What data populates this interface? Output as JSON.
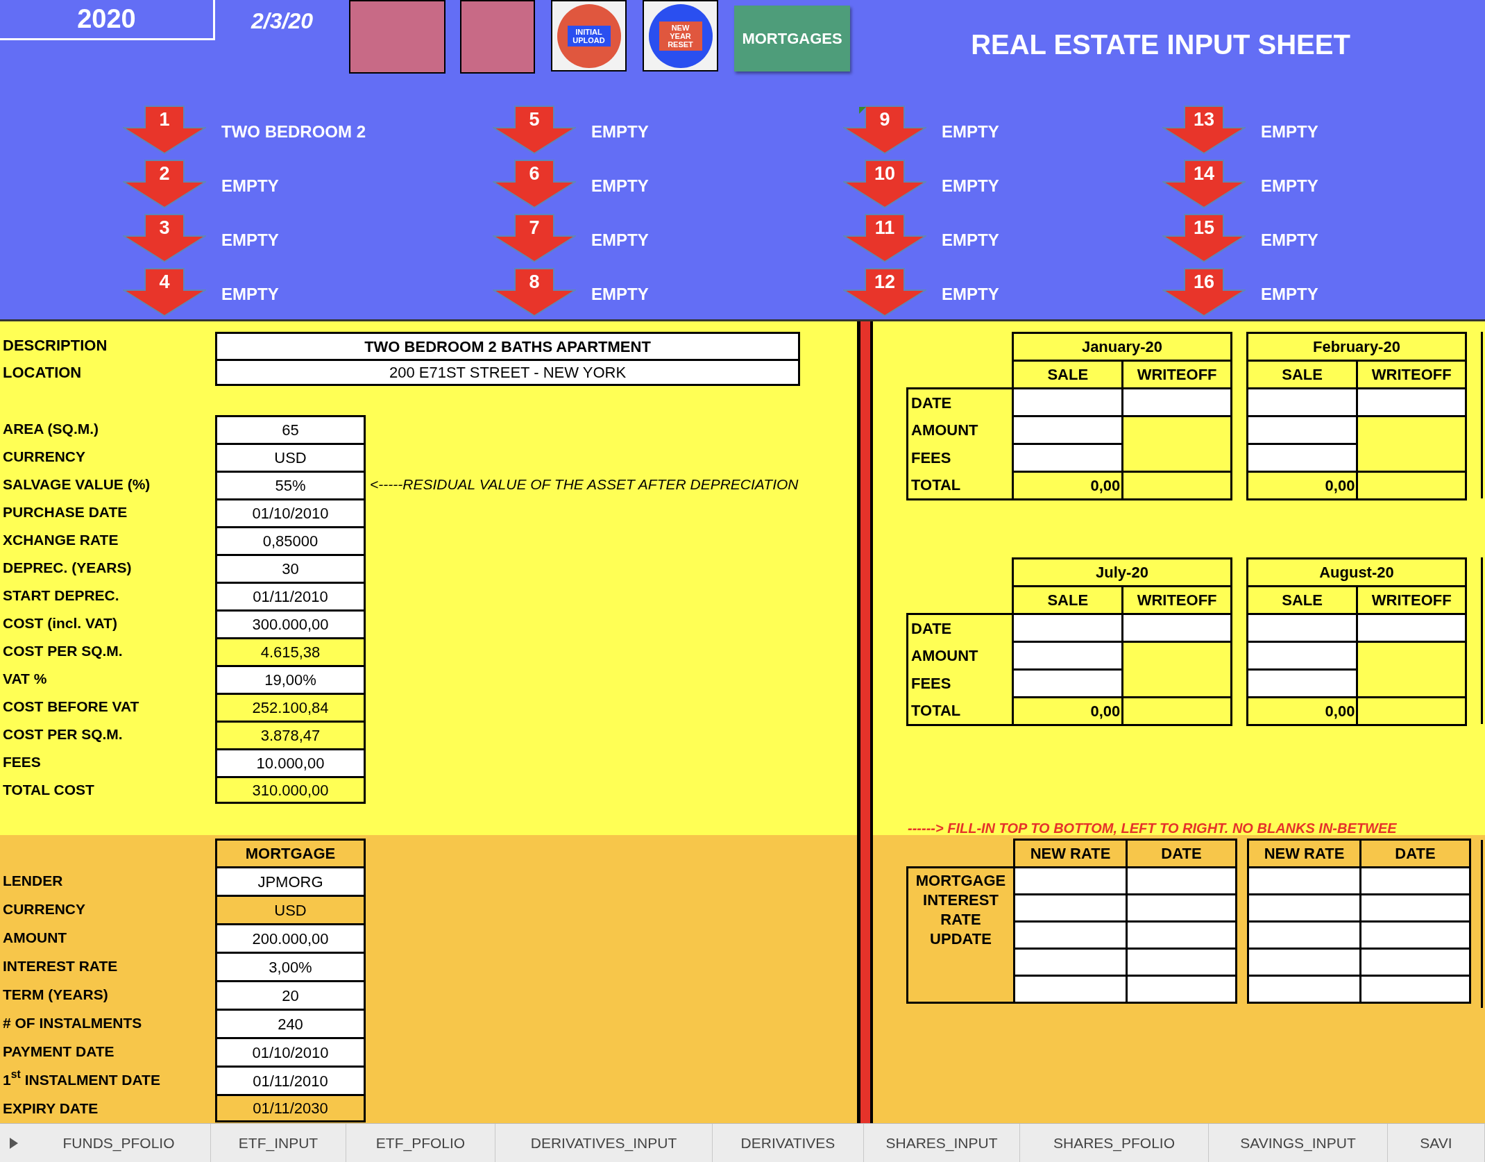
{
  "header": {
    "year": "2020",
    "date": "2/3/20",
    "title": "REAL ESTATE INPUT SHEET",
    "shortcuts": [
      {
        "kind": "picture"
      },
      {
        "kind": "picture"
      },
      {
        "kind": "redbadge",
        "label": "INITIAL UPLOAD"
      },
      {
        "kind": "bluebadge",
        "label": "NEW YEAR RESET"
      },
      {
        "kind": "button",
        "label": "MORTGAGES"
      }
    ]
  },
  "slots": [
    {
      "number": "1",
      "label": "TWO BEDROOM 2"
    },
    {
      "number": "2",
      "label": "EMPTY"
    },
    {
      "number": "3",
      "label": "EMPTY"
    },
    {
      "number": "4",
      "label": "EMPTY"
    },
    {
      "number": "5",
      "label": "EMPTY"
    },
    {
      "number": "6",
      "label": "EMPTY"
    },
    {
      "number": "7",
      "label": "EMPTY"
    },
    {
      "number": "8",
      "label": "EMPTY"
    },
    {
      "number": "9",
      "label": "EMPTY"
    },
    {
      "number": "10",
      "label": "EMPTY"
    },
    {
      "number": "11",
      "label": "EMPTY"
    },
    {
      "number": "12",
      "label": "EMPTY"
    },
    {
      "number": "13",
      "label": "EMPTY"
    },
    {
      "number": "14",
      "label": "EMPTY"
    },
    {
      "number": "15",
      "label": "EMPTY"
    },
    {
      "number": "16",
      "label": "EMPTY"
    }
  ],
  "property": {
    "identity": [
      {
        "label": "DESCRIPTION",
        "value": "TWO BEDROOM 2 BATHS APARTMENT"
      },
      {
        "label": "LOCATION",
        "value": "200 E71ST STREET - NEW YORK"
      }
    ],
    "details": [
      {
        "label": "AREA (SQ.M.)",
        "value": "65",
        "calculated": false
      },
      {
        "label": "CURRENCY",
        "value": "USD",
        "calculated": false
      },
      {
        "label": "SALVAGE VALUE (%)",
        "value": "55%",
        "calculated": false,
        "note": "<-----RESIDUAL VALUE OF THE ASSET AFTER DEPRECIATION"
      },
      {
        "label": "PURCHASE DATE",
        "value": "01/10/2010",
        "calculated": false
      },
      {
        "label": "XCHANGE RATE",
        "value": "0,85000",
        "calculated": false
      },
      {
        "label": "DEPREC. (YEARS)",
        "value": "30",
        "calculated": false
      },
      {
        "label": "START DEPREC.",
        "value": "01/11/2010",
        "calculated": false
      },
      {
        "label": "COST (incl. VAT)",
        "value": "300.000,00",
        "calculated": false
      },
      {
        "label": "COST PER SQ.M.",
        "value": "4.615,38",
        "calculated": true
      },
      {
        "label": "VAT %",
        "value": "19,00%",
        "calculated": false
      },
      {
        "label": "COST BEFORE VAT",
        "value": "252.100,84",
        "calculated": true
      },
      {
        "label": "COST PER SQ.M.",
        "value": "3.878,47",
        "calculated": true
      },
      {
        "label": "FEES",
        "value": "10.000,00",
        "calculated": false
      },
      {
        "label": "TOTAL COST",
        "value": "310.000,00",
        "calculated": true
      }
    ]
  },
  "mortgage": {
    "header": "MORTGAGE",
    "rows": [
      {
        "label": "LENDER",
        "value": "JPMORG",
        "calculated": false
      },
      {
        "label": "CURRENCY",
        "value": "USD",
        "calculated": true
      },
      {
        "label": "AMOUNT",
        "value": "200.000,00",
        "calculated": false
      },
      {
        "label": "INTEREST RATE",
        "value": "3,00%",
        "calculated": false
      },
      {
        "label": "TERM (YEARS)",
        "value": "20",
        "calculated": false
      },
      {
        "label": "# OF INSTALMENTS",
        "value": "240",
        "calculated": false
      },
      {
        "label": "PAYMENT DATE",
        "value": "01/10/2010",
        "calculated": false
      },
      {
        "label": "1$^{st}$ INSTALMENT DATE",
        "value": "01/11/2010",
        "calculated": false
      },
      {
        "label": "EXPIRY DATE",
        "value": "01/11/2030",
        "calculated": true
      }
    ]
  },
  "transactions": [
    {
      "rows": [
        {
          "label": "DATE",
          "kind": "both"
        },
        {
          "label": "AMOUNT",
          "kind": "sale"
        },
        {
          "label": "FEES",
          "kind": "sale"
        },
        {
          "label": "TOTAL",
          "kind": "total"
        }
      ],
      "months": [
        {
          "month": "January-20",
          "columns": [
            "SALE",
            "WRITEOFF"
          ],
          "total": "0,00"
        },
        {
          "month": "February-20",
          "columns": [
            "SALE",
            "WRITEOFF"
          ],
          "total": "0,00"
        }
      ]
    },
    {
      "rows": [
        {
          "label": "DATE",
          "kind": "both"
        },
        {
          "label": "AMOUNT",
          "kind": "sale"
        },
        {
          "label": "FEES",
          "kind": "sale"
        },
        {
          "label": "TOTAL",
          "kind": "total"
        }
      ],
      "months": [
        {
          "month": "July-20",
          "columns": [
            "SALE",
            "WRITEOFF"
          ],
          "total": "0,00"
        },
        {
          "month": "August-20",
          "columns": [
            "SALE",
            "WRITEOFF"
          ],
          "total": "0,00"
        }
      ]
    }
  ],
  "fill_note": "------> FILL-IN TOP TO BOTTOM, LEFT TO RIGHT. NO BLANKS IN-BETWEE",
  "rate_updates": {
    "label_lines": [
      "MORTGAGE",
      "INTEREST",
      "RATE",
      "UPDATE"
    ],
    "groups": [
      {
        "columns": [
          "NEW RATE",
          "DATE"
        ]
      },
      {
        "columns": [
          "NEW RATE",
          "DATE"
        ]
      }
    ]
  },
  "sheet_tabs": [
    {
      "label": "FUNDS_PFOLIO",
      "selected": false
    },
    {
      "label": "ETF_INPUT",
      "selected": false
    },
    {
      "label": "ETF_PFOLIO",
      "selected": false
    },
    {
      "label": "DERIVATIVES_INPUT",
      "selected": false
    },
    {
      "label": "DERIVATIVES",
      "selected": false
    },
    {
      "label": "SHARES_INPUT",
      "selected": false
    },
    {
      "label": "SHARES_PFOLIO",
      "selected": false
    },
    {
      "label": "SAVINGS_INPUT",
      "selected": false
    },
    {
      "label": "SAVI",
      "selected": false
    }
  ]
}
